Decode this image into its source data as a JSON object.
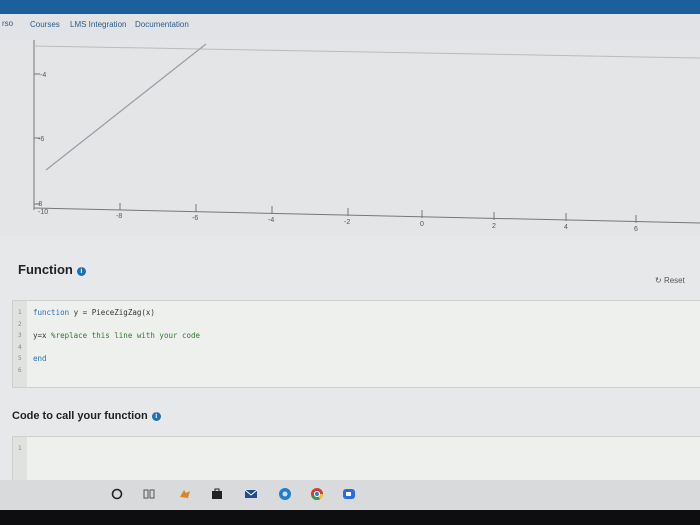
{
  "nav": {
    "logo_fragment": "rso",
    "items": [
      "Courses",
      "LMS Integration",
      "Documentation"
    ]
  },
  "plot": {
    "y_ticks": [
      "-4",
      "-6",
      "-8"
    ],
    "x_ticks": [
      "-10",
      "-8",
      "-6",
      "-4",
      "-2",
      "0",
      "2",
      "4",
      "6"
    ]
  },
  "function_section": {
    "title": "Function",
    "reset_label": "Reset",
    "line_numbers": [
      "1",
      "2",
      "3",
      "4",
      "5",
      "6"
    ],
    "code": {
      "line1_kw": "function",
      "line1_rest": " y = PieceZigZag(x)",
      "line3_code": "y=x",
      "line3_comment": " %replace this line with your code",
      "line5_kw": "end"
    }
  },
  "call_section": {
    "title": "Code to call your function",
    "line_numbers": [
      "1"
    ]
  },
  "colors": {
    "accent": "#1c5f9e",
    "keyword": "#2a6bbf",
    "comment": "#2f7a2f"
  }
}
